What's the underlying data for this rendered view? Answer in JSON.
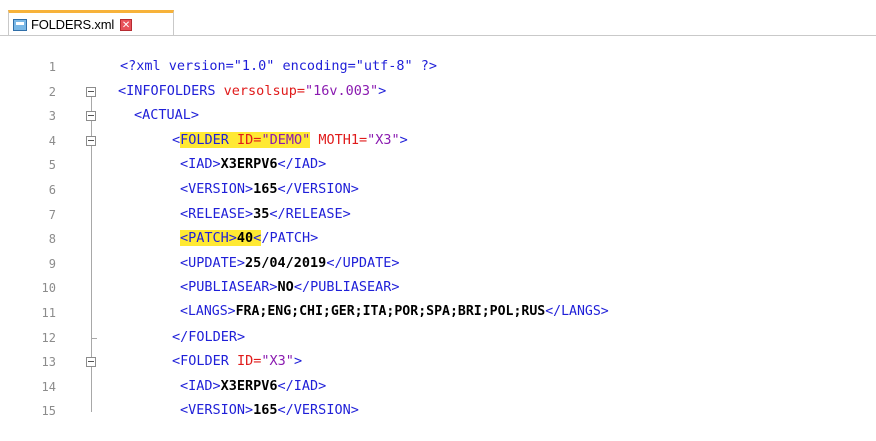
{
  "tab": {
    "label": "FOLDERS.xml",
    "close_glyph": "✕",
    "icon": "file-save-icon"
  },
  "colors": {
    "tag": "#1f1fd8",
    "attr": "#e01b1b",
    "value": "#8a1ab0",
    "highlight": "#ffe933",
    "tab_accent": "#f7b23a"
  },
  "lines": [
    {
      "num": "1",
      "indent": 0
    },
    {
      "num": "2",
      "indent": 0
    },
    {
      "num": "3",
      "indent": 1
    },
    {
      "num": "4",
      "indent": 2
    },
    {
      "num": "5",
      "indent": 3
    },
    {
      "num": "6",
      "indent": 3
    },
    {
      "num": "7",
      "indent": 3
    },
    {
      "num": "8",
      "indent": 3
    },
    {
      "num": "9",
      "indent": 3
    },
    {
      "num": "10",
      "indent": 3
    },
    {
      "num": "11",
      "indent": 3
    },
    {
      "num": "12",
      "indent": 2
    },
    {
      "num": "13",
      "indent": 2
    },
    {
      "num": "14",
      "indent": 3
    },
    {
      "num": "15",
      "indent": 3
    }
  ],
  "code": {
    "l1": {
      "pi": "<?xml version=\"1.0\" encoding=\"utf-8\" ?>"
    },
    "l2": {
      "open": "<INFOFOLDERS",
      "attr": " versolsup=",
      "val": "\"16v.003\"",
      "close": ">"
    },
    "l3": {
      "tag": "<ACTUAL>"
    },
    "l4": {
      "lt": "<",
      "name": "FOLDER",
      "attr1": " ID=",
      "val1": "\"DEMO\"",
      "attr2": " MOTH1=",
      "val2": "\"X3\"",
      "close": ">"
    },
    "l5": {
      "open": "<IAD>",
      "text": "X3ERPV6",
      "close": "</IAD>"
    },
    "l6": {
      "open": "<VERSION>",
      "text": "165",
      "close": "</VERSION>"
    },
    "l7": {
      "open": "<RELEASE>",
      "text": "35",
      "close": "</RELEASE>"
    },
    "l8": {
      "open": "<PATCH>",
      "text": "40",
      "lt": "<",
      "close": "/PATCH>"
    },
    "l9": {
      "open": "<UPDATE>",
      "text": "25/04/2019",
      "close": "</UPDATE>"
    },
    "l10": {
      "open": "<PUBLIASEAR>",
      "text": "NO",
      "close": "</PUBLIASEAR>"
    },
    "l11": {
      "open": "<LANGS>",
      "text": "FRA;ENG;CHI;GER;ITA;POR;SPA;BRI;POL;RUS",
      "close": "</LANGS>"
    },
    "l12": {
      "tag": "</FOLDER>"
    },
    "l13": {
      "open": "<FOLDER",
      "attr": " ID=",
      "val": "\"X3\"",
      "close": ">"
    },
    "l14": {
      "open": "<IAD>",
      "text": "X3ERPV6",
      "close": "</IAD>"
    },
    "l15": {
      "open": "<VERSION>",
      "text": "165",
      "close": "</VERSION>"
    }
  }
}
